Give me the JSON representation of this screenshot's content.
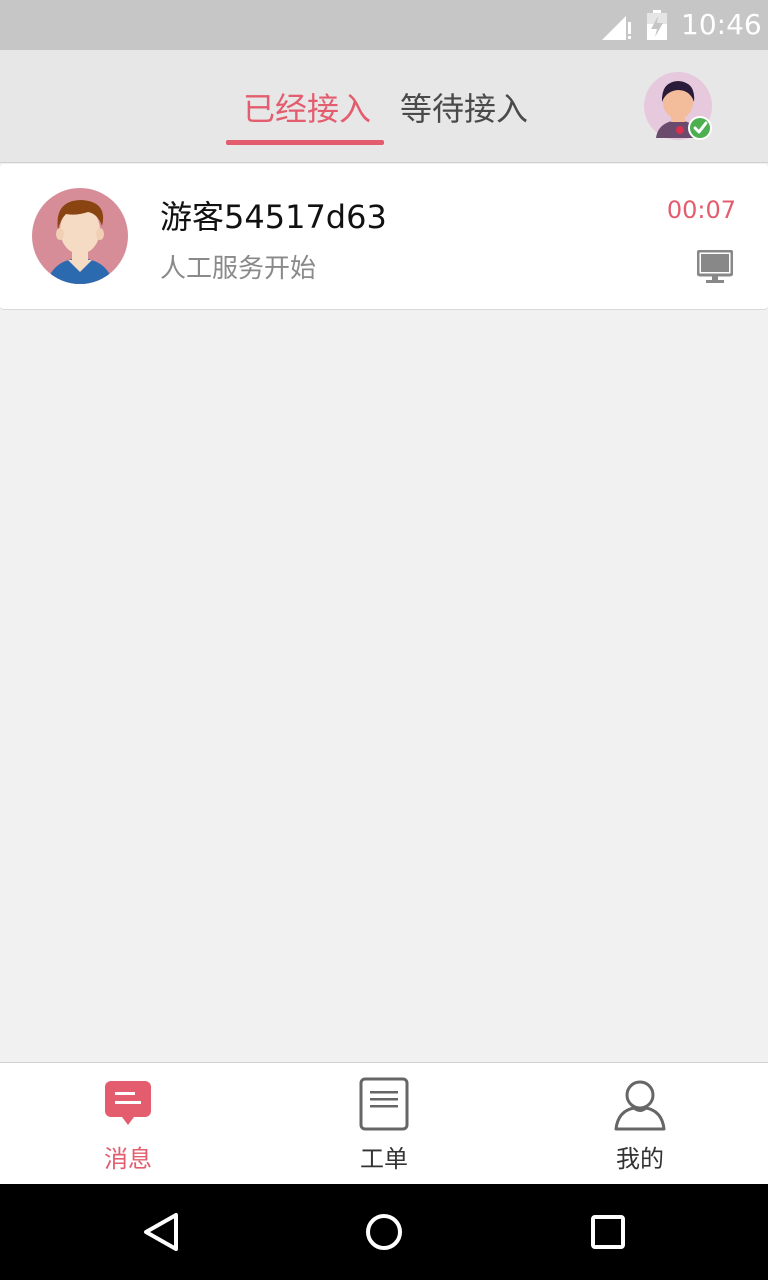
{
  "status_bar": {
    "time": "10:46"
  },
  "header": {
    "tabs": [
      {
        "label": "已经接入",
        "active": true
      },
      {
        "label": "等待接入",
        "active": false
      }
    ],
    "agent_status": "online"
  },
  "conversations": [
    {
      "name": "游客54517d63",
      "last_message": "人工服务开始",
      "time": "00:07",
      "device_icon": "desktop-icon"
    }
  ],
  "bottom_nav": {
    "items": [
      {
        "label": "消息",
        "icon": "message-icon",
        "active": true
      },
      {
        "label": "工单",
        "icon": "ticket-icon",
        "active": false
      },
      {
        "label": "我的",
        "icon": "profile-icon",
        "active": false
      }
    ]
  },
  "colors": {
    "accent": "#e35d6e",
    "header_bg": "#e7e7e7",
    "content_bg": "#f1f1f1"
  }
}
